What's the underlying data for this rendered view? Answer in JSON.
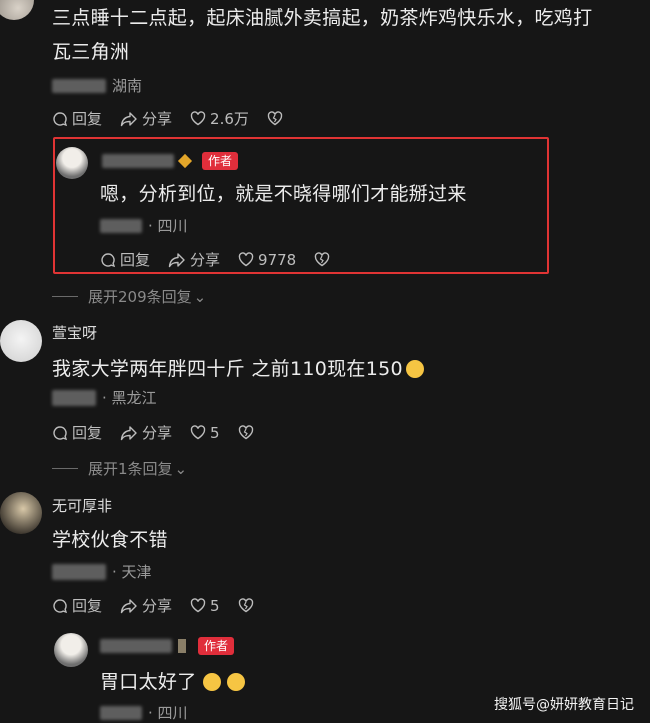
{
  "top_comment": {
    "text_line1": "三点睡十二点起，起床油腻外卖搞起，奶茶炸鸡快乐水，吃鸡打",
    "text_line2": "瓦三角洲",
    "location": "湖南",
    "reply_label": "回复",
    "share_label": "分享",
    "like_count": "2.6万"
  },
  "author_reply_1": {
    "badge": "作者",
    "text": "嗯，分析到位，就是不晓得哪们才能掰过来",
    "location": "· 四川",
    "reply_label": "回复",
    "share_label": "分享",
    "like_count": "9778"
  },
  "expand_1": "展开209条回复",
  "comment_2": {
    "username": "萱宝呀",
    "text": "我家大学两年胖四十斤 之前110现在150",
    "location": "· 黑龙江",
    "reply_label": "回复",
    "share_label": "分享",
    "like_count": "5"
  },
  "expand_2": "展开1条回复",
  "comment_3": {
    "username": "无可厚非",
    "text": "学校伙食不错",
    "location": "· 天津",
    "reply_label": "回复",
    "share_label": "分享",
    "like_count": "5"
  },
  "author_reply_2": {
    "badge": "作者",
    "text": "胃口太好了",
    "location": "· 四川"
  },
  "watermark": "搜狐号@妍妍教育日记",
  "colors": {
    "accent_red": "#e03434",
    "badge_red": "#e02e3b",
    "background": "#161616"
  }
}
